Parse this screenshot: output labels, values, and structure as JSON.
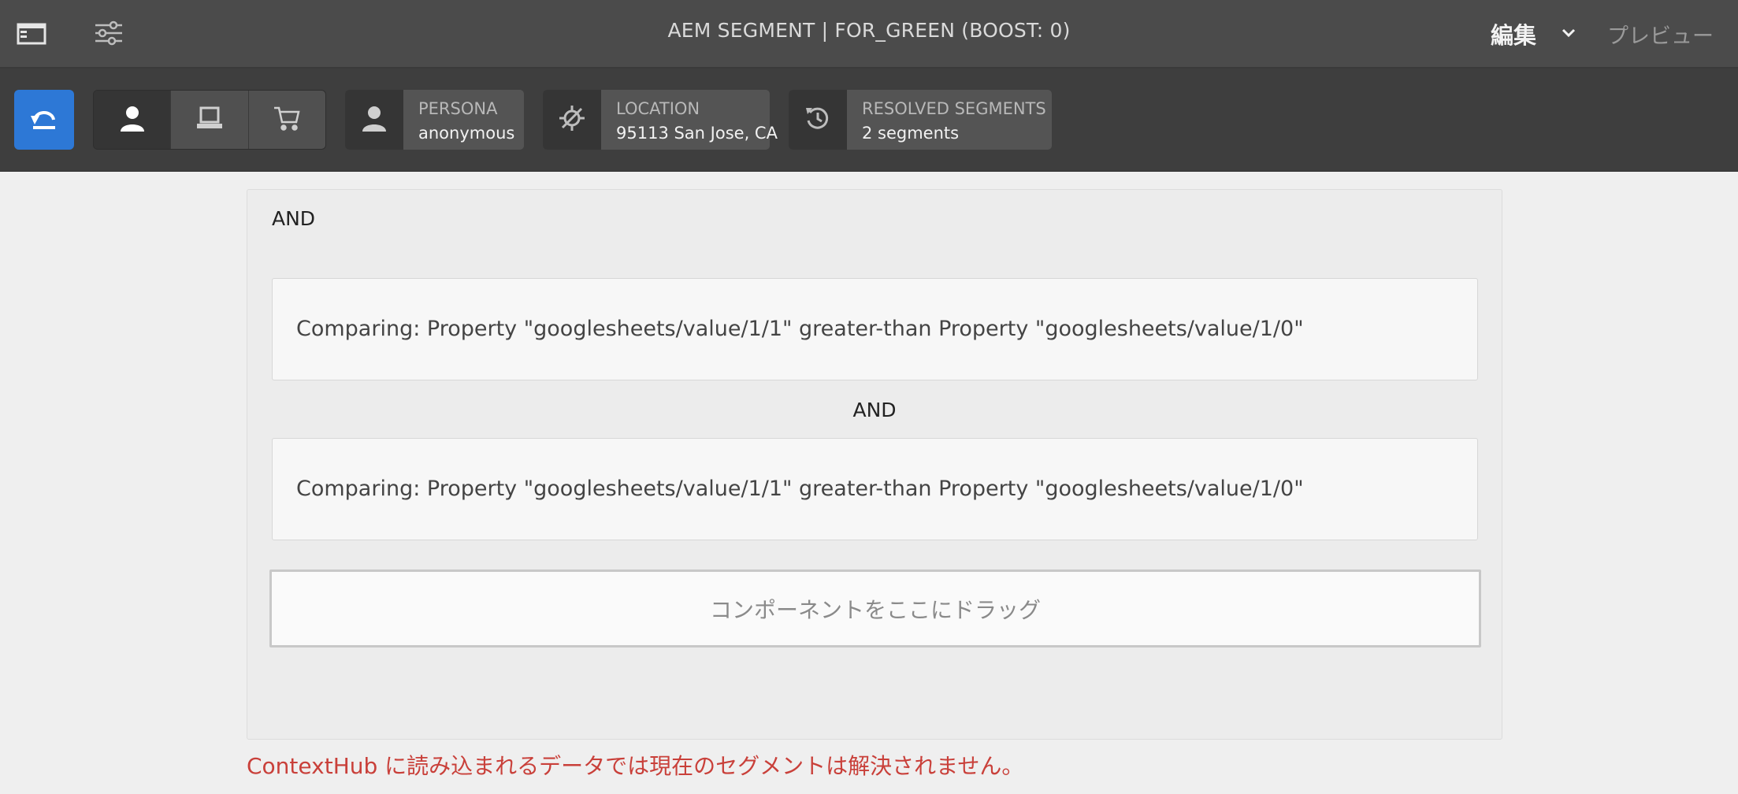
{
  "header": {
    "title": "AEM SEGMENT | FOR_GREEN (BOOST: 0)",
    "mode_edit": "編集",
    "mode_preview": "プレビュー"
  },
  "contexthub": {
    "modules": [
      {
        "label": "PERSONA",
        "value": "anonymous",
        "icon": "person-icon"
      },
      {
        "label": "LOCATION",
        "value": "95113 San Jose, CA",
        "icon": "location-off-icon"
      },
      {
        "label": "RESOLVED SEGMENTS",
        "value": "2 segments",
        "icon": "refresh-icon"
      }
    ]
  },
  "segment": {
    "and_top": "AND",
    "conditions": [
      "Comparing: Property \"googlesheets/value/1/1\" greater-than Property \"googlesheets/value/1/0\"",
      "Comparing: Property \"googlesheets/value/1/1\" greater-than Property \"googlesheets/value/1/0\""
    ],
    "and_middle": "AND",
    "dropzone": "コンポーネントをここにドラッグ"
  },
  "status": {
    "error": "ContextHub に読み込まれるデータでは現在のセグメントは解決されません。"
  },
  "colors": {
    "accent": "#2d78d6",
    "error": "#c9403a",
    "topbar": "#4b4b4b",
    "contextbar": "#3e3e3e"
  }
}
